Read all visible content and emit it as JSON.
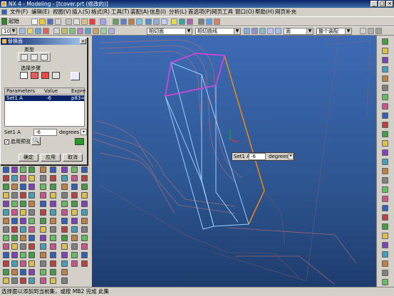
{
  "window": {
    "title": "NX 4 - Modeling - [tcover.prt (修改的)]",
    "min": "_",
    "max": "□",
    "close": "×"
  },
  "menu": [
    "文件(F)",
    "编辑(E)",
    "视图(V)",
    "插入(S)",
    "格式(R)",
    "工具(T)",
    "装配(A)",
    "信息(I)",
    "分析(L)",
    "首选项(P)",
    "网页工具",
    "窗口(O)",
    "帮助(H)",
    "网页补充"
  ],
  "toolbar": {
    "start_label": "起始",
    "zoom_value": "100",
    "section_combo": "相切面",
    "curve_combo": "相切曲线",
    "face_combo": "面",
    "select_combo": "整个装配"
  },
  "dialog": {
    "title": "替换面",
    "type_label": "类型",
    "steps_label": "选择步骤",
    "table_headers": [
      "Parameters",
      "Value",
      "Expre"
    ],
    "table_rows": [
      [
        "Set1 A",
        "-6",
        "p83="
      ]
    ],
    "param_label": "Set1 A",
    "param_value": "-6",
    "param_unit": "degrees",
    "preview_label": "启用预览",
    "ok_label": "确定",
    "apply_label": "应用",
    "cancel_label": "取消"
  },
  "onscreen_input": {
    "label": "Set1 A",
    "value": "-6",
    "unit": "degrees"
  },
  "status": {
    "text": "选择面以添加到当前集，或按 MB2 完成 此集"
  },
  "colors": {
    "viewport_top": "#3d6bb4",
    "viewport_bottom": "#1e3c6e",
    "selected_face": "#e040e0",
    "highlight_edge": "#ff8000",
    "title_bar": "#0a246a"
  }
}
